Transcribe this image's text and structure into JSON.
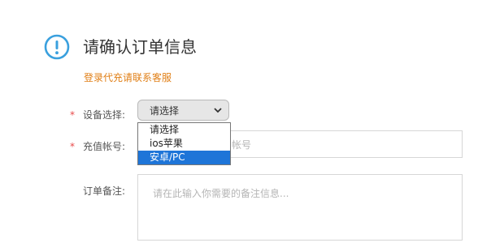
{
  "header": {
    "icon": "exclamation-circle-icon",
    "title": "请确认订单信息",
    "hint": "登录代充请联系客服",
    "accent_color": "#3aa0de",
    "hint_color": "#e07f16"
  },
  "form": {
    "device": {
      "label": "设备选择:",
      "required_mark": "*",
      "selected": "请选择",
      "options": [
        "请选择",
        "ios苹果",
        "安卓/PC"
      ],
      "highlighted_option": "安卓/PC"
    },
    "account": {
      "label": "充值帐号:",
      "required_mark": "*",
      "placeholder_visible": "帐号"
    },
    "remark": {
      "label": "订单备注:",
      "placeholder": "请在此输入你需要的备注信息..."
    }
  }
}
